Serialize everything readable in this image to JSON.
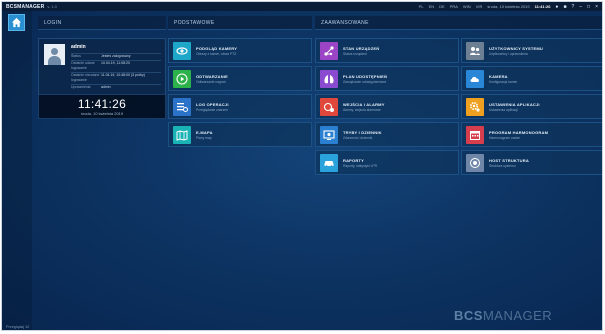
{
  "topbar": {
    "brand": "BCSMANAGER",
    "brand_sub": "v. 1.0",
    "items": [
      "PL",
      "EN",
      "DE",
      "PRA",
      "WIN",
      "VIR"
    ],
    "date": "środa, 10 kwietnia 2019",
    "time": "11:41:26"
  },
  "sections": {
    "login": "LOGIN",
    "basic": "PODSTAWOWE",
    "advanced": "ZAAWANSOWANE"
  },
  "login": {
    "name": "admin",
    "rows": [
      {
        "label": "Status",
        "value": "Jesteś zalogowany"
      },
      {
        "label": "Ostatnie udane logowanie",
        "value": "10.04.19, 11:08:20"
      },
      {
        "label": "Ostatnie nieudane logowanie",
        "value": "11.04.19, 10:48:00 (3 próby)"
      },
      {
        "label": "Uprawnienia",
        "value": "admin"
      }
    ]
  },
  "clock": {
    "time": "11:41:26",
    "date": "środa, 10 kwietnia 2019"
  },
  "tiles_basic": [
    {
      "title": "PODGLĄD KAMERY",
      "subtitle": "Obrazy z kamer, obraz PTZ",
      "icon": "eye-icon",
      "color": "#1ea7c9"
    },
    {
      "title": "ODTWARZANIE",
      "subtitle": "Odtwarzanie nagrań",
      "icon": "play-icon",
      "color": "#2db14a"
    },
    {
      "title": "LOG OPERACJI",
      "subtitle": "Przeglądanie zdarzeń",
      "icon": "log-list-icon",
      "color": "#2a73c9"
    },
    {
      "title": "E-MAPA",
      "subtitle": "Plany map",
      "icon": "map-icon",
      "color": "#19b3b5"
    }
  ],
  "tiles_adv_left": [
    {
      "title": "STAN URZĄDZEŃ",
      "subtitle": "Status urządzeń",
      "icon": "devices-icon",
      "color": "#9b45c6"
    },
    {
      "title": "PLAN UDOSTĘPNIEŃ",
      "subtitle": "Zarządzanie udostępnieniami",
      "icon": "lungs-icon",
      "color": "#8a4bd0"
    },
    {
      "title": "WEJŚCIA I ALARMY",
      "subtitle": "Alarmy, wejścia alarmowe",
      "icon": "alarm-icon",
      "color": "#e0483c"
    },
    {
      "title": "TRYBY I DZIENNIK",
      "subtitle": "Zdarzenia i dziennik",
      "icon": "monitor-icon",
      "color": "#2a7fd0"
    },
    {
      "title": "RAPORTY",
      "subtitle": "Raporty, statystyki LPR",
      "icon": "car-icon",
      "color": "#2aa2db"
    }
  ],
  "tiles_adv_right": [
    {
      "title": "UŻYTKOWNICY SYSTEMU",
      "subtitle": "Użytkownicy i uprawnienia",
      "icon": "users-icon",
      "color": "#6d7f93"
    },
    {
      "title": "KAMERA",
      "subtitle": "Konfiguracja kamer",
      "icon": "cloud-icon",
      "color": "#2a86d6"
    },
    {
      "title": "USTAWIENIA APLIKACJI",
      "subtitle": "Ustawienia aplikacji",
      "icon": "gear-icon",
      "color": "#f0a020"
    },
    {
      "title": "PROGRAM HARMONOGRAM",
      "subtitle": "Harmonogram zadań",
      "icon": "calendar-icon",
      "color": "#d63d4d"
    },
    {
      "title": "HOST STRUKTURA",
      "subtitle": "Struktura systemu",
      "icon": "host-icon",
      "color": "#6f86a8"
    }
  ],
  "logo": {
    "bold": "BCS",
    "light": "MANAGER"
  },
  "footer": {
    "label": "Przeglądaj 10"
  }
}
